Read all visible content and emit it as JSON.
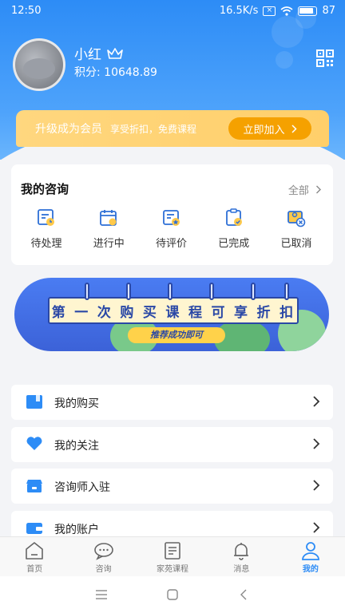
{
  "status_bar": {
    "time": "12:50",
    "network_speed": "16.5K/s",
    "battery": "87"
  },
  "profile": {
    "username": "小红",
    "points": "积分: 10648.89"
  },
  "vip_banner": {
    "title": "升级成为会员",
    "subtitle": "享受折扣，免费课程",
    "button": "立即加入"
  },
  "consult": {
    "title": "我的咨询",
    "all_link": "全部",
    "items": [
      {
        "label": "待处理",
        "icon": "pending-icon"
      },
      {
        "label": "进行中",
        "icon": "in-progress-icon"
      },
      {
        "label": "待评价",
        "icon": "review-icon"
      },
      {
        "label": "已完成",
        "icon": "completed-icon"
      },
      {
        "label": "已取消",
        "icon": "cancelled-icon"
      }
    ]
  },
  "promo": {
    "chars": [
      "第",
      "一",
      "次",
      "购",
      "买",
      "课",
      "程",
      "可",
      "享",
      "折",
      "扣"
    ],
    "tag": "推荐成功即可"
  },
  "menu": [
    {
      "label": "我的购买",
      "icon": "purchase-icon"
    },
    {
      "label": "我的关注",
      "icon": "heart-icon"
    },
    {
      "label": "咨询师入驻",
      "icon": "shop-icon"
    },
    {
      "label": "我的账户",
      "icon": "wallet-icon"
    }
  ],
  "tabs": [
    {
      "label": "首页",
      "icon": "home-icon"
    },
    {
      "label": "咨询",
      "icon": "chat-icon"
    },
    {
      "label": "家苑课程",
      "icon": "course-icon"
    },
    {
      "label": "消息",
      "icon": "bell-icon"
    },
    {
      "label": "我的",
      "icon": "user-icon",
      "active": true
    }
  ],
  "colors": {
    "primary": "#2d8cf6",
    "vip_gold": "#ffd77f",
    "vip_button": "#f5a100"
  }
}
